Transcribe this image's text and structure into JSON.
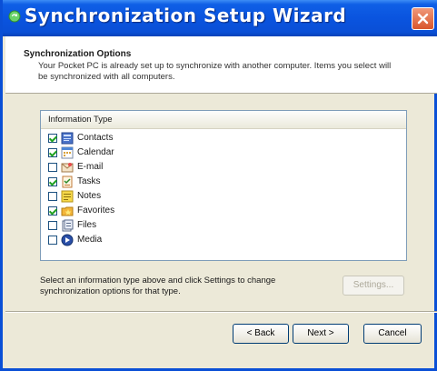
{
  "window": {
    "title": "Synchronization Setup Wizard"
  },
  "header": {
    "title": "Synchronization Options",
    "description": "Your Pocket PC is already set up to synchronize with another computer. Items you select will be synchronized with all computers."
  },
  "list": {
    "column_header": "Information Type",
    "items": [
      {
        "label": "Contacts",
        "checked": true,
        "icon": "contacts-icon"
      },
      {
        "label": "Calendar",
        "checked": true,
        "icon": "calendar-icon"
      },
      {
        "label": "E-mail",
        "checked": false,
        "icon": "email-icon"
      },
      {
        "label": "Tasks",
        "checked": true,
        "icon": "tasks-icon"
      },
      {
        "label": "Notes",
        "checked": false,
        "icon": "notes-icon"
      },
      {
        "label": "Favorites",
        "checked": true,
        "icon": "favorites-icon"
      },
      {
        "label": "Files",
        "checked": false,
        "icon": "files-icon"
      },
      {
        "label": "Media",
        "checked": false,
        "icon": "media-icon"
      }
    ]
  },
  "hint": "Select an information type above and click Settings to change synchronization options for that type.",
  "buttons": {
    "settings": "Settings...",
    "back": "< Back",
    "next": "Next >",
    "cancel": "Cancel"
  }
}
